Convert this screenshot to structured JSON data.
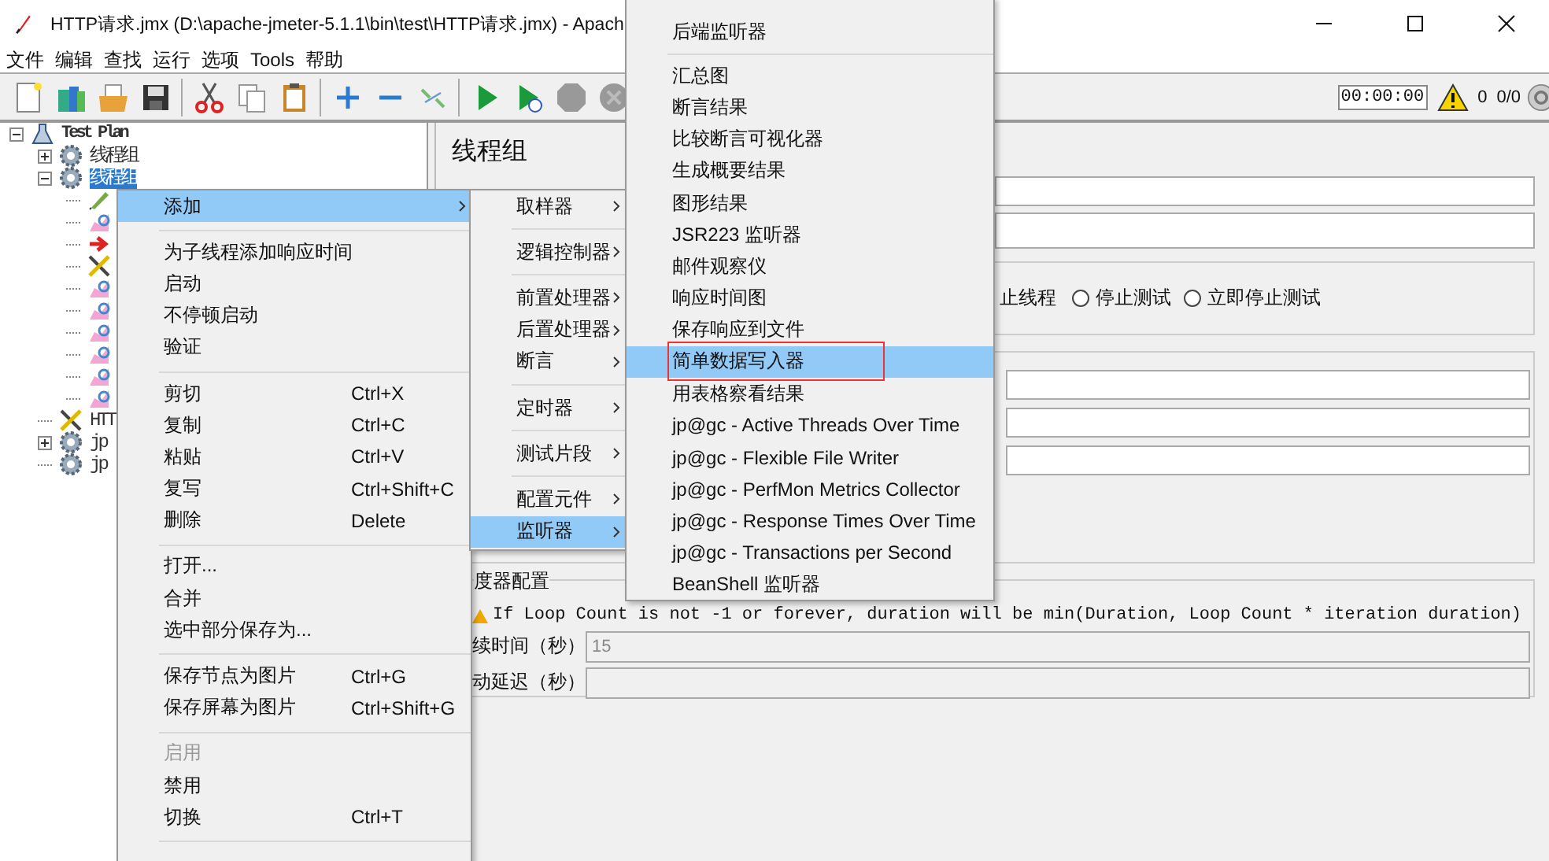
{
  "window": {
    "title": "HTTP请求.jmx (D:\\apache-jmeter-5.1.1\\bin\\test\\HTTP请求.jmx) - Apach"
  },
  "menu_bar": [
    "文件",
    "编辑",
    "查找",
    "运行",
    "选项",
    "Tools",
    "帮助"
  ],
  "toolbar": {
    "timer": "00:00:00",
    "warning_count": "0",
    "threads": "0/0"
  },
  "tree": {
    "items": [
      {
        "label": "Test Plan",
        "kind": "plan",
        "expanded": true,
        "selected": false,
        "children": [
          {
            "label": "线程组",
            "kind": "thread_group",
            "expanded": false,
            "selected": false
          },
          {
            "label": "线程组",
            "kind": "thread_group",
            "expanded": true,
            "selected": true,
            "children": [
              {
                "kind": "sampler",
                "selected": false
              },
              {
                "kind": "listener",
                "selected": false
              },
              {
                "kind": "preprocessor",
                "selected": false
              },
              {
                "kind": "config",
                "selected": false
              },
              {
                "kind": "listener",
                "selected": false
              },
              {
                "kind": "listener",
                "selected": false
              },
              {
                "kind": "listener",
                "selected": false
              },
              {
                "kind": "listener",
                "selected": false
              },
              {
                "kind": "listener",
                "selected": false
              },
              {
                "kind": "listener",
                "selected": false
              }
            ]
          },
          {
            "label": "HTT",
            "kind": "config",
            "selected": false
          },
          {
            "label": "jp",
            "kind": "thread_group",
            "expanded": false,
            "selected": false
          },
          {
            "label": "jp",
            "kind": "thread_group",
            "selected": false
          }
        ]
      }
    ]
  },
  "panel": {
    "title": "线程组",
    "error_action": {
      "partial_label": "止线程",
      "options": [
        {
          "label": "停止测试",
          "selected": false
        },
        {
          "label": "立即停止测试",
          "selected": false
        }
      ]
    },
    "scheduler": {
      "legend": "度器配置",
      "warning": "If Loop Count is not -1 or forever, duration will be min(Duration, Loop Count * iteration duration)",
      "fields": [
        {
          "label": "续时间（秒）",
          "value": "15",
          "disabled": true
        },
        {
          "label": "动延迟（秒）",
          "disabled": true
        }
      ]
    }
  },
  "context_menu": {
    "items": [
      {
        "kind": "item",
        "label": "添加",
        "selected": true,
        "disabled": false,
        "submenu": true
      },
      {
        "kind": "separator"
      },
      {
        "kind": "item",
        "label": "为子线程添加响应时间",
        "selected": false,
        "disabled": false,
        "submenu": false
      },
      {
        "kind": "item",
        "label": "启动",
        "selected": false,
        "disabled": false,
        "submenu": false
      },
      {
        "kind": "item",
        "label": "不停顿启动",
        "selected": false,
        "disabled": false,
        "submenu": false
      },
      {
        "kind": "item",
        "label": "验证",
        "selected": false,
        "disabled": false,
        "submenu": false
      },
      {
        "kind": "separator"
      },
      {
        "kind": "item",
        "label": "剪切",
        "shortcut": "Ctrl+X",
        "selected": false,
        "disabled": false,
        "submenu": false
      },
      {
        "kind": "item",
        "label": "复制",
        "shortcut": "Ctrl+C",
        "selected": false,
        "disabled": false,
        "submenu": false
      },
      {
        "kind": "item",
        "label": "粘贴",
        "shortcut": "Ctrl+V",
        "selected": false,
        "disabled": false,
        "submenu": false
      },
      {
        "kind": "item",
        "label": "复写",
        "shortcut": "Ctrl+Shift+C",
        "selected": false,
        "disabled": false,
        "submenu": false
      },
      {
        "kind": "item",
        "label": "删除",
        "shortcut": "Delete",
        "selected": false,
        "disabled": false,
        "submenu": false
      },
      {
        "kind": "separator"
      },
      {
        "kind": "item",
        "label": "打开...",
        "selected": false,
        "disabled": false,
        "submenu": false
      },
      {
        "kind": "item",
        "label": "合并",
        "selected": false,
        "disabled": false,
        "submenu": false
      },
      {
        "kind": "item",
        "label": "选中部分保存为...",
        "selected": false,
        "disabled": false,
        "submenu": false
      },
      {
        "kind": "separator"
      },
      {
        "kind": "item",
        "label": "保存节点为图片",
        "shortcut": "Ctrl+G",
        "selected": false,
        "disabled": false,
        "submenu": false
      },
      {
        "kind": "item",
        "label": "保存屏幕为图片",
        "shortcut": "Ctrl+Shift+G",
        "selected": false,
        "disabled": false,
        "submenu": false
      },
      {
        "kind": "separator"
      },
      {
        "kind": "item",
        "label": "启用",
        "selected": false,
        "disabled": true,
        "submenu": false
      },
      {
        "kind": "item",
        "label": "禁用",
        "selected": false,
        "disabled": false,
        "submenu": false
      },
      {
        "kind": "item",
        "label": "切换",
        "shortcut": "Ctrl+T",
        "selected": false,
        "disabled": false,
        "submenu": false
      },
      {
        "kind": "separator"
      }
    ]
  },
  "add_submenu": {
    "items": [
      {
        "kind": "item",
        "label": "取样器",
        "selected": false
      },
      {
        "kind": "separator"
      },
      {
        "kind": "item",
        "label": "逻辑控制器",
        "selected": false
      },
      {
        "kind": "separator"
      },
      {
        "kind": "item",
        "label": "前置处理器",
        "selected": false
      },
      {
        "kind": "item",
        "label": "后置处理器",
        "selected": false
      },
      {
        "kind": "item",
        "label": "断言",
        "selected": false
      },
      {
        "kind": "separator"
      },
      {
        "kind": "item",
        "label": "定时器",
        "selected": false
      },
      {
        "kind": "separator"
      },
      {
        "kind": "item",
        "label": "测试片段",
        "selected": false
      },
      {
        "kind": "separator"
      },
      {
        "kind": "item",
        "label": "配置元件",
        "selected": false
      },
      {
        "kind": "item",
        "label": "监听器",
        "selected": true
      }
    ]
  },
  "listener_submenu": {
    "items": [
      {
        "kind": "item",
        "label": "后端监听器",
        "selected": false,
        "outlined": false
      },
      {
        "kind": "separator"
      },
      {
        "kind": "item",
        "label": "汇总图",
        "selected": false,
        "outlined": false
      },
      {
        "kind": "item",
        "label": "断言结果",
        "selected": false,
        "outlined": false
      },
      {
        "kind": "item",
        "label": "比较断言可视化器",
        "selected": false,
        "outlined": false
      },
      {
        "kind": "item",
        "label": "生成概要结果",
        "selected": false,
        "outlined": false
      },
      {
        "kind": "item",
        "label": "图形结果",
        "selected": false,
        "outlined": false
      },
      {
        "kind": "item",
        "label": "JSR223 监听器",
        "selected": false,
        "outlined": false
      },
      {
        "kind": "item",
        "label": "邮件观察仪",
        "selected": false,
        "outlined": false
      },
      {
        "kind": "item",
        "label": "响应时间图",
        "selected": false,
        "outlined": false
      },
      {
        "kind": "item",
        "label": "保存响应到文件",
        "selected": false,
        "outlined": false
      },
      {
        "kind": "item",
        "label": "简单数据写入器",
        "selected": true,
        "outlined": true
      },
      {
        "kind": "item",
        "label": "用表格察看结果",
        "selected": false,
        "outlined": false
      },
      {
        "kind": "item",
        "label": "jp@gc - Active Threads Over Time",
        "selected": false,
        "outlined": false
      },
      {
        "kind": "item",
        "label": "jp@gc - Flexible File Writer",
        "selected": false,
        "outlined": false
      },
      {
        "kind": "item",
        "label": "jp@gc - PerfMon Metrics Collector",
        "selected": false,
        "outlined": false
      },
      {
        "kind": "item",
        "label": "jp@gc - Response Times Over Time",
        "selected": false,
        "outlined": false
      },
      {
        "kind": "item",
        "label": "jp@gc - Transactions per Second",
        "selected": false,
        "outlined": false
      },
      {
        "kind": "item",
        "label": "BeanShell 监听器",
        "selected": false,
        "outlined": false
      }
    ]
  }
}
